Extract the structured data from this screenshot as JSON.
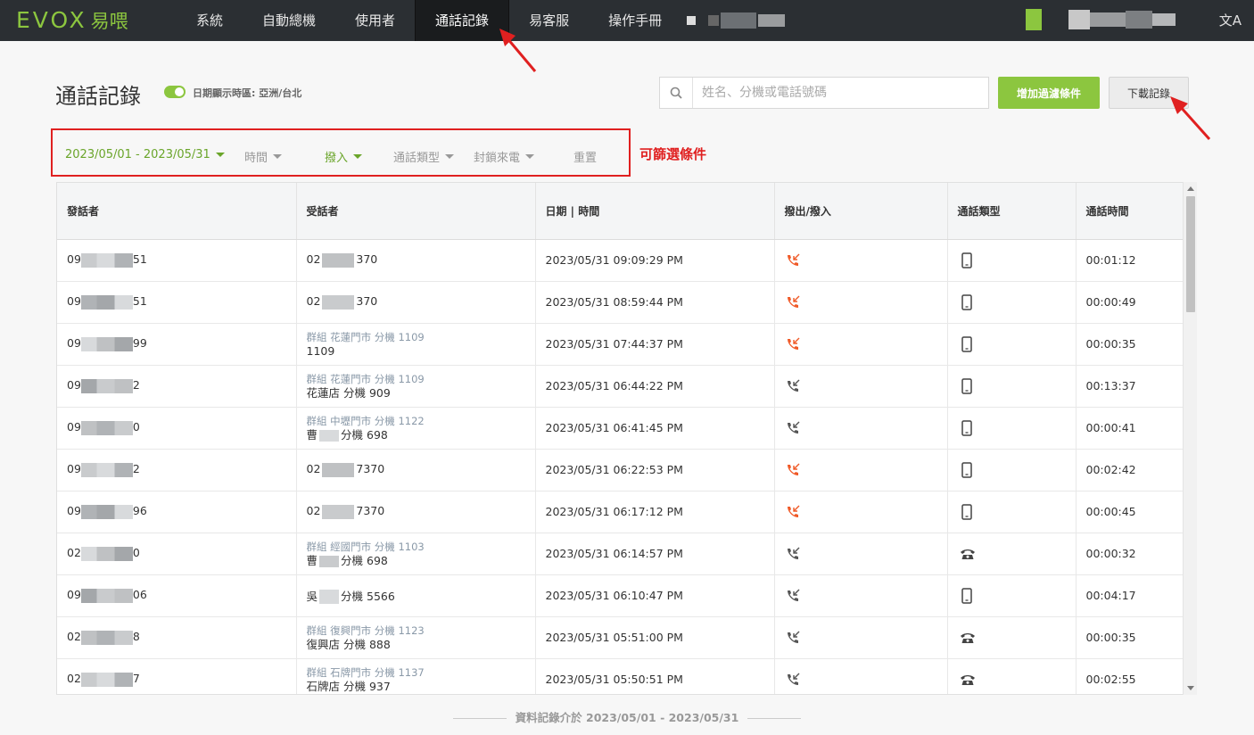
{
  "brand": {
    "logo_text": "EVOX",
    "logo_cn": "易喂",
    "accent": "#8cc63f"
  },
  "nav": {
    "items": [
      {
        "label": "系統"
      },
      {
        "label": "自動總機"
      },
      {
        "label": "使用者"
      },
      {
        "label": "通話記錄",
        "active": true
      },
      {
        "label": "易客服"
      },
      {
        "label": "操作手冊"
      }
    ],
    "translate_icon": "translate-icon"
  },
  "header": {
    "title": "通話記錄",
    "timezone_label": "日期顯示時區: 亞洲/台北",
    "search_placeholder": "姓名、分機或電話號碼",
    "add_filter_label": "增加過濾條件",
    "download_label": "下載記錄"
  },
  "filters": {
    "date_range": "2023/05/01 - 2023/05/31",
    "time": "時間",
    "direction": "撥入",
    "call_type": "通話類型",
    "blocked": "封鎖來電",
    "reset": "重置",
    "annotation": "可篩選條件"
  },
  "table": {
    "headers": [
      "發話者",
      "受話者",
      "日期 | 時間",
      "撥出/撥入",
      "通話類型",
      "通話時間"
    ],
    "rows": [
      {
        "caller": "09",
        "caller_end": "51",
        "callee_group": "",
        "callee": "02",
        "callee_end": "370",
        "datetime": "2023/05/31 09:09:29 PM",
        "direction": "missed",
        "type": "mobile",
        "duration": "00:01:12"
      },
      {
        "caller": "09",
        "caller_end": "51",
        "callee_group": "",
        "callee": "02",
        "callee_end": "370",
        "datetime": "2023/05/31 08:59:44 PM",
        "direction": "missed",
        "type": "mobile",
        "duration": "00:00:49"
      },
      {
        "caller": "09",
        "caller_end": "99",
        "callee_group": "群組  花蓮門市  分機 1109",
        "callee": "1109",
        "callee_end": "",
        "datetime": "2023/05/31 07:44:37 PM",
        "direction": "missed",
        "type": "mobile",
        "duration": "00:00:35"
      },
      {
        "caller": "09",
        "caller_end": "2",
        "callee_group": "群組  花蓮門市  分機 1109",
        "callee": "花蓮店 分機 909",
        "callee_end": "",
        "datetime": "2023/05/31 06:44:22 PM",
        "direction": "in",
        "type": "mobile",
        "duration": "00:13:37"
      },
      {
        "caller": "09",
        "caller_end": "0",
        "callee_group": "群組  中壢門市  分機 1122",
        "callee": "曹",
        "callee_end": "分機 698",
        "datetime": "2023/05/31 06:41:45 PM",
        "direction": "in",
        "type": "mobile",
        "duration": "00:00:41"
      },
      {
        "caller": "09",
        "caller_end": "2",
        "callee_group": "",
        "callee": "02",
        "callee_end": "7370",
        "datetime": "2023/05/31 06:22:53 PM",
        "direction": "missed",
        "type": "mobile",
        "duration": "00:02:42"
      },
      {
        "caller": "09",
        "caller_end": "96",
        "callee_group": "",
        "callee": "02",
        "callee_end": "7370",
        "datetime": "2023/05/31 06:17:12 PM",
        "direction": "missed",
        "type": "mobile",
        "duration": "00:00:45"
      },
      {
        "caller": "02",
        "caller_end": "0",
        "callee_group": "群組  經國門市  分機 1103",
        "callee": "曹",
        "callee_end": "分機 698",
        "datetime": "2023/05/31 06:14:57 PM",
        "direction": "in",
        "type": "landline",
        "duration": "00:00:32"
      },
      {
        "caller": "09",
        "caller_end": "06",
        "callee_group": "",
        "callee": "吳",
        "callee_end": "分機 5566",
        "datetime": "2023/05/31 06:10:47 PM",
        "direction": "in",
        "type": "mobile",
        "duration": "00:04:17"
      },
      {
        "caller": "02",
        "caller_end": "8",
        "callee_group": "群組  復興門市  分機 1123",
        "callee": "復興店  分機 888",
        "callee_end": "",
        "datetime": "2023/05/31 05:51:00 PM",
        "direction": "in",
        "type": "landline",
        "duration": "00:00:35"
      },
      {
        "caller": "02",
        "caller_end": "7",
        "callee_group": "群組  石牌門市  分機 1137",
        "callee": "石牌店 分機 937",
        "callee_end": "",
        "datetime": "2023/05/31 05:50:51 PM",
        "direction": "in",
        "type": "landline",
        "duration": "00:02:55"
      }
    ]
  },
  "footer": {
    "note": "資料記錄介於 2023/05/01 - 2023/05/31"
  },
  "colors": {
    "missed": "#f05a28",
    "in": "#555555",
    "annotation_red": "#e02020"
  }
}
